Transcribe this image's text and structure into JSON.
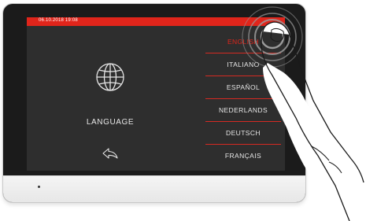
{
  "status_bar": {
    "datetime": "06.10.2018  19:08"
  },
  "language_panel": {
    "title": "LANGUAGE",
    "icon": "globe-icon",
    "back_icon": "back-arrow-icon"
  },
  "languages": {
    "items": [
      {
        "label": "ENGLISH",
        "selected": true
      },
      {
        "label": "ITALIANO",
        "selected": false
      },
      {
        "label": "ESPAÑOL",
        "selected": false
      },
      {
        "label": "NEDERLANDS",
        "selected": false
      },
      {
        "label": "DEUTSCH",
        "selected": false
      },
      {
        "label": "FRANÇAIS",
        "selected": false
      }
    ]
  },
  "colors": {
    "accent": "#e0251b",
    "screen_bg": "#2e2e2e",
    "text": "#e6e6e6"
  }
}
